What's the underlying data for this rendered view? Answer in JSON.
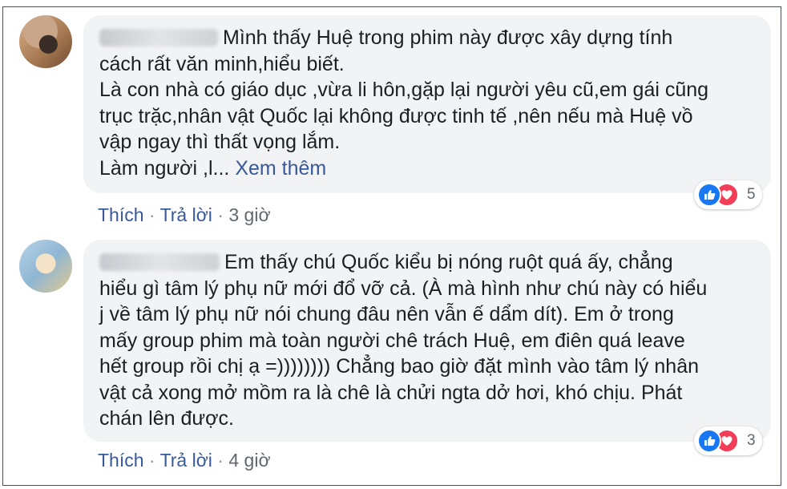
{
  "comments": [
    {
      "avatar": "profile-photo",
      "text": "Mình thấy Huệ trong phim này được xây dựng tính cách rất văn minh,hiểu biết.",
      "lines": [
        "cách rất văn minh,hiểu biết.",
        "Là con nhà có giáo dục ,vừa li hôn,gặp lại người yêu cũ,em gái cũng",
        "trục trặc,nhân vật Quốc lại không được tinh tế ,nên nếu mà Huệ vồ",
        "vập ngay thì thất vọng lắm."
      ],
      "first_line": "Mình thấy Huệ trong phim này được xây dựng tính",
      "last_line_prefix": "Làm người ,l...",
      "see_more": "Xem thêm",
      "like_label": "Thích",
      "reply_label": "Trả lời",
      "time": "3 giờ",
      "reaction_count": "5"
    },
    {
      "avatar": "profile-photo",
      "first_line": "Em thấy chú Quốc kiểu bị nóng ruột quá ấy, chẳng",
      "lines": [
        "hiểu gì tâm lý phụ nữ mới đổ vỡ cả. (À mà hình như chú này có hiểu",
        "j về tâm lý phụ nữ nói chung đâu nên vẫn ế dẩm dít). Em ở trong",
        "mấy group phim mà toàn người chê trách Huệ, em điên quá leave",
        "hết group rồi chị ạ =)))))))) Chẳng bao giờ đặt mình vào tâm lý nhân",
        "vật cả xong mở mồm ra là chê là chửi ngta dở hơi, khó chịu. Phát",
        "chán lên được."
      ],
      "like_label": "Thích",
      "reply_label": "Trả lời",
      "time": "4 giờ",
      "reaction_count": "3"
    }
  ],
  "separator": "·",
  "colors": {
    "link": "#385898",
    "bubble": "#f2f3f5",
    "like": "#1877f2",
    "love": "#f33e58"
  }
}
